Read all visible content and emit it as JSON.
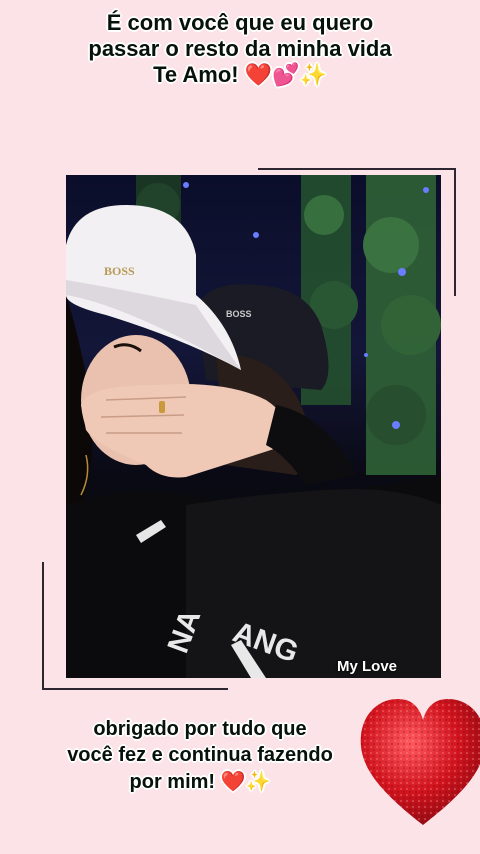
{
  "top_caption": {
    "line1": "É com você que eu quero",
    "line2": "passar o resto da minha vida",
    "line3_text": "Te Amo!",
    "line3_emoji": "❤️💕✨"
  },
  "photo": {
    "overlay_label": "My Love",
    "cap_logo_text": "BOSS"
  },
  "bottom_caption": {
    "line1": "obrigado por tudo que",
    "line2": "você fez e continua fazendo",
    "line3_text": "por mim!",
    "line3_emoji": "❤️✨"
  },
  "colors": {
    "background": "#fbe3e8",
    "caption_text": "#06120a",
    "frame": "#2d2530",
    "heart": "#d2141e"
  }
}
